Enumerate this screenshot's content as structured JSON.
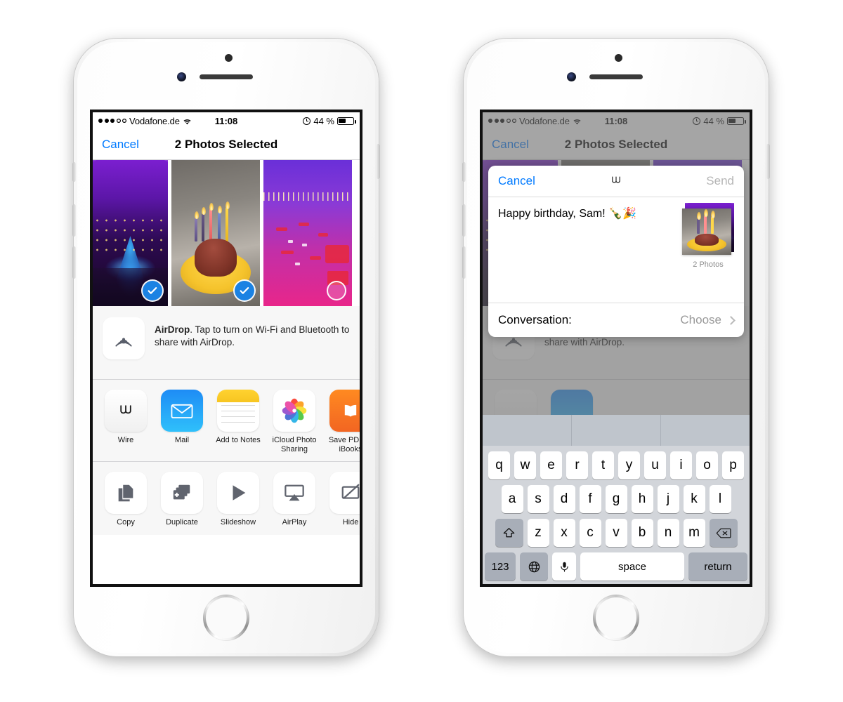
{
  "status_bar": {
    "carrier": "Vodafone.de",
    "signal_dots_filled": 3,
    "signal_dots_total": 5,
    "wifi_icon": "wifi-icon",
    "time": "11:08",
    "alarm_icon": "alarm-icon",
    "battery_percent": "44 %",
    "battery_icon": "battery-icon"
  },
  "nav_bar": {
    "cancel_label": "Cancel",
    "title": "2 Photos Selected"
  },
  "photos": [
    {
      "name": "sony-center-christmas-tree",
      "selected": true,
      "check_icon": "checkmark-icon"
    },
    {
      "name": "birthday-cupcake-candles",
      "selected": true,
      "check_icon": "checkmark-icon"
    },
    {
      "name": "airport-night-aerial",
      "selected": false,
      "check_icon": "empty-circle-icon"
    }
  ],
  "airdrop": {
    "icon": "airdrop-icon",
    "title": "AirDrop",
    "description": ". Tap to turn on Wi-Fi and Bluetooth to share with AirDrop."
  },
  "share_apps": [
    {
      "label": "Wire",
      "icon": "wire-app-icon"
    },
    {
      "label": "Mail",
      "icon": "mail-app-icon"
    },
    {
      "label": "Add to Notes",
      "icon": "notes-app-icon"
    },
    {
      "label": "iCloud Photo Sharing",
      "icon": "icloud-photos-app-icon"
    },
    {
      "label": "Save PDF to iBooks",
      "icon": "ibooks-app-icon"
    },
    {
      "label": "",
      "icon": "green-app-icon"
    }
  ],
  "actions": [
    {
      "label": "Copy",
      "icon": "copy-icon"
    },
    {
      "label": "Duplicate",
      "icon": "duplicate-icon"
    },
    {
      "label": "Slideshow",
      "icon": "play-icon"
    },
    {
      "label": "AirPlay",
      "icon": "airplay-icon"
    },
    {
      "label": "Hide",
      "icon": "hide-icon"
    }
  ],
  "compose_sheet": {
    "cancel_label": "Cancel",
    "logo_icon": "wire-logo-icon",
    "send_label": "Send",
    "message": "Happy birthday, Sam! 🍾🎉",
    "attachment_count": "2 Photos",
    "conversation_label": "Conversation:",
    "conversation_value": "Choose",
    "chevron_icon": "chevron-right-icon"
  },
  "keyboard": {
    "row1": [
      "q",
      "w",
      "e",
      "r",
      "t",
      "y",
      "u",
      "i",
      "o",
      "p"
    ],
    "row2": [
      "a",
      "s",
      "d",
      "f",
      "g",
      "h",
      "j",
      "k",
      "l"
    ],
    "row3": [
      "z",
      "x",
      "c",
      "v",
      "b",
      "n",
      "m"
    ],
    "shift_icon": "shift-icon",
    "backspace_icon": "backspace-icon",
    "numbers_label": "123",
    "globe_icon": "globe-icon",
    "mic_icon": "microphone-icon",
    "space_label": "space",
    "return_label": "return"
  },
  "colors": {
    "accent_blue": "#007aff",
    "selection_blue": "#1b82e3",
    "sheet_bg": "#f7f7f7",
    "keyboard_bg": "#d2d5da"
  }
}
